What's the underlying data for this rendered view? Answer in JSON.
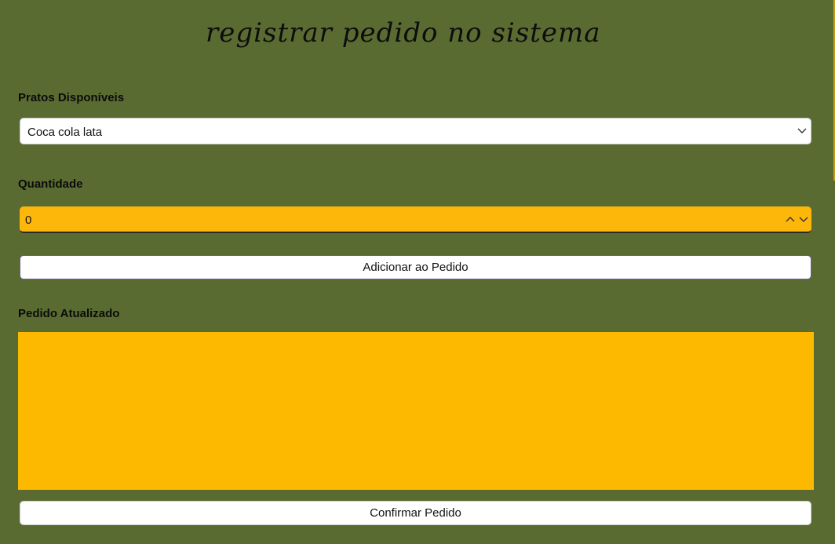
{
  "page": {
    "title": "registrar pedido no sistema"
  },
  "pratos": {
    "label": "Pratos Disponíveis",
    "selected": "Coca cola lata",
    "icon": "chevron-down-icon"
  },
  "quantidade": {
    "label": "Quantidade",
    "value": "0",
    "icons": [
      "chevron-up-icon",
      "chevron-down-icon"
    ]
  },
  "actions": {
    "add_label": "Adicionar ao Pedido",
    "confirm_label": "Confirmar Pedido"
  },
  "pedido": {
    "label": "Pedido Atualizado",
    "content": ""
  },
  "colors": {
    "background": "#5a6b31",
    "accent": "#fdb800",
    "button": "#ffffff"
  }
}
